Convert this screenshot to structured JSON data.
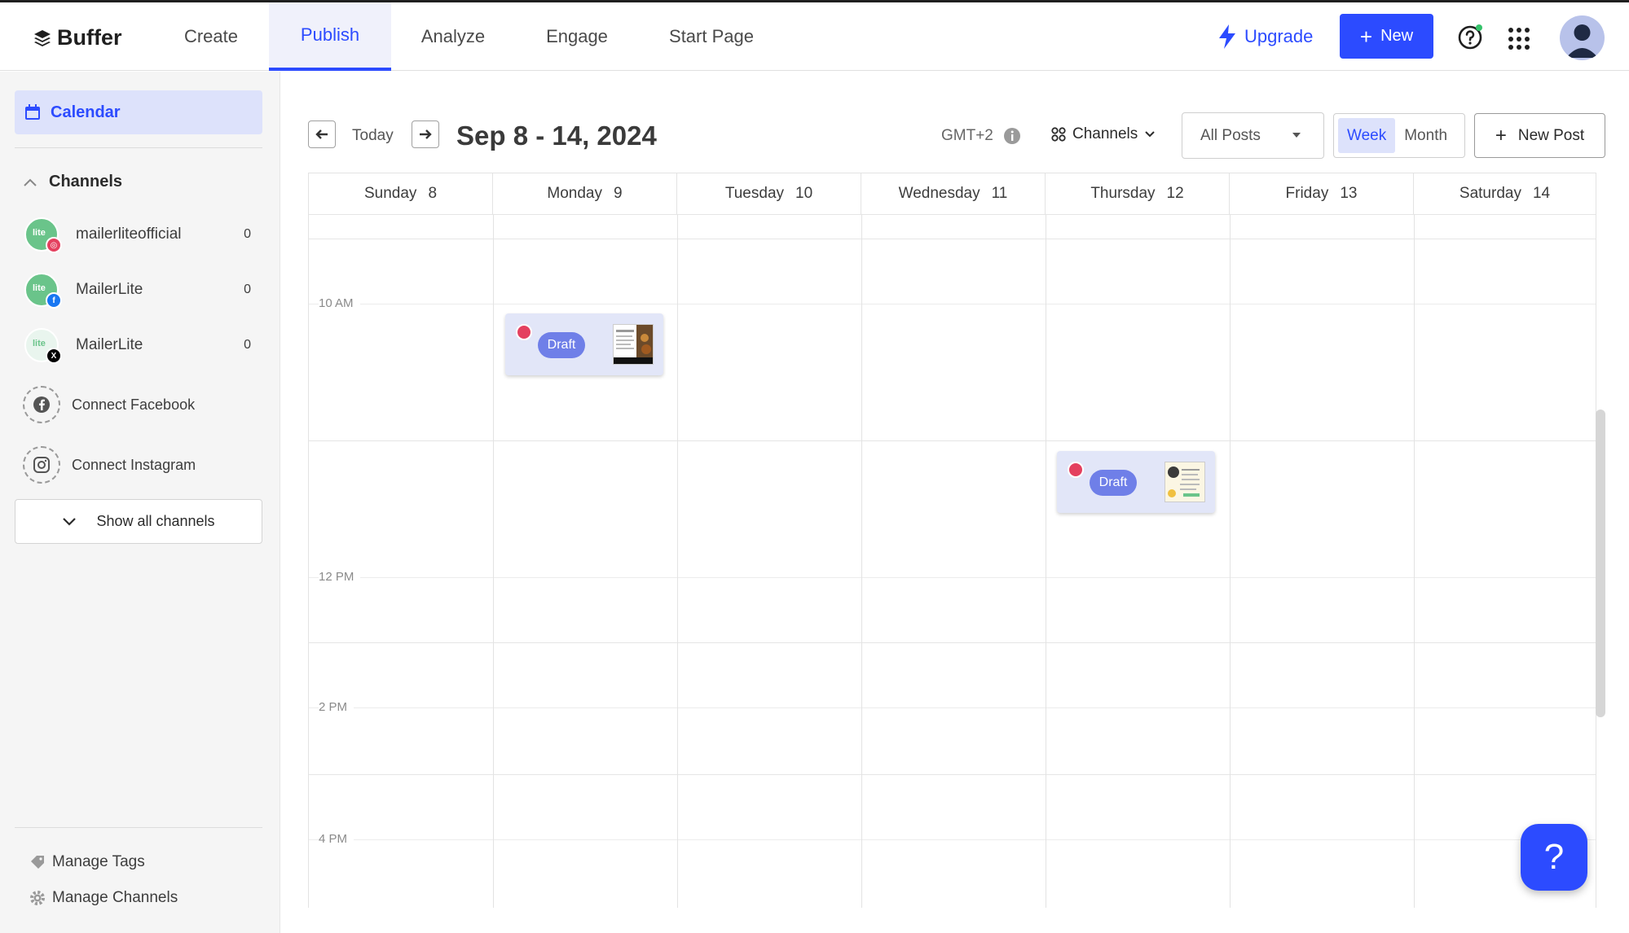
{
  "header": {
    "logo": "Buffer",
    "tabs": [
      "Create",
      "Publish",
      "Analyze",
      "Engage",
      "Start Page"
    ],
    "active_tab": "Publish",
    "upgrade_label": "Upgrade",
    "new_label": "New"
  },
  "sidebar": {
    "calendar_label": "Calendar",
    "channels_heading": "Channels",
    "channels": [
      {
        "name": "mailerliteofficial",
        "network": "instagram",
        "count": "0"
      },
      {
        "name": "MailerLite",
        "network": "facebook",
        "count": "0"
      },
      {
        "name": "MailerLite",
        "network": "x",
        "count": "0"
      }
    ],
    "connect_facebook": "Connect Facebook",
    "connect_instagram": "Connect Instagram",
    "show_all_label": "Show all channels",
    "manage_tags": "Manage Tags",
    "manage_channels": "Manage Channels"
  },
  "toolbar": {
    "today_label": "Today",
    "date_range": "Sep 8 - 14, 2024",
    "timezone": "GMT+2",
    "channels_dropdown": "Channels",
    "posts_filter": "All Posts",
    "view_week": "Week",
    "view_month": "Month",
    "active_view": "Week",
    "new_post_label": "New Post"
  },
  "calendar": {
    "days": [
      {
        "name": "Sunday",
        "date": "8"
      },
      {
        "name": "Monday",
        "date": "9"
      },
      {
        "name": "Tuesday",
        "date": "10"
      },
      {
        "name": "Wednesday",
        "date": "11"
      },
      {
        "name": "Thursday",
        "date": "12"
      },
      {
        "name": "Friday",
        "date": "13"
      },
      {
        "name": "Saturday",
        "date": "14"
      }
    ],
    "hour_labels": [
      "10 AM",
      "12 PM",
      "2 PM",
      "4 PM"
    ],
    "posts": [
      {
        "day": "Monday",
        "status": "Draft",
        "network": "instagram"
      },
      {
        "day": "Thursday",
        "status": "Draft",
        "network": "instagram"
      }
    ]
  },
  "colors": {
    "accent": "#2c4bff",
    "instagram": "#e4405f",
    "facebook": "#1877f2",
    "x": "#000000",
    "channel_avatar": "#6ac48a"
  }
}
